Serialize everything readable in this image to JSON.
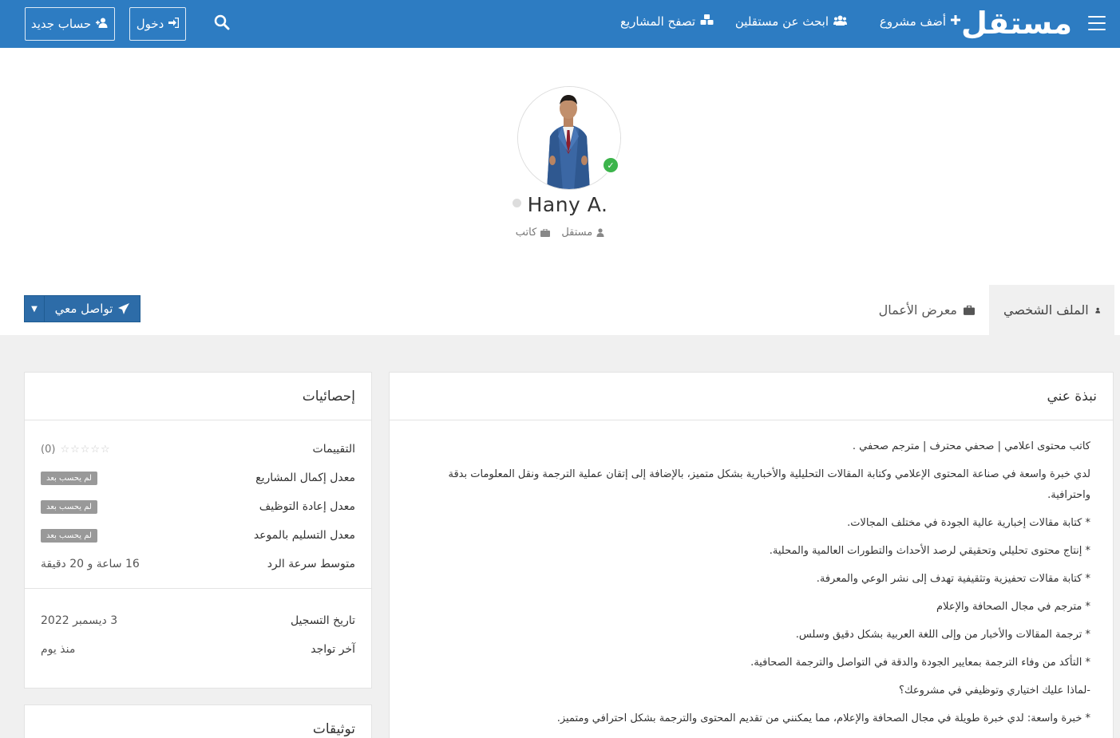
{
  "navbar": {
    "logo": "مستقل",
    "add_project": "أضف مشروع",
    "find_freelancers": "ابحث عن مستقلين",
    "browse_projects": "تصفح المشاريع",
    "login": "دخول",
    "register": "حساب جديد",
    "bg_color": "#2d7cc2"
  },
  "profile": {
    "name": "Hany A.",
    "role": "مستقل",
    "title": "كاتب",
    "verified": true
  },
  "tabs": {
    "profile": "الملف الشخصي",
    "portfolio": "معرض الأعمال"
  },
  "contact": {
    "label": "تواصل معي"
  },
  "about": {
    "heading": "نبذة عني",
    "paragraphs": [
      "كاتب محتوى اعلامي | صحفي محترف | مترجم صحفي .",
      "لدي خبرة واسعة في صناعة المحتوى الإعلامي وكتابة المقالات التحليلية والأخبارية بشكل متميز، بالإضافة إلى إتقان عملية الترجمة ونقل المعلومات بدقة واحترافية.",
      "* كتابة مقالات إخبارية عالية الجودة في مختلف المجالات.",
      "* إنتاج محتوى تحليلي وتحقيقي لرصد الأحداث والتطورات العالمية والمحلية.",
      "* كتابة مقالات تحفيزية وتثقيفية تهدف إلى نشر الوعي والمعرفة.",
      "* مترجم في مجال الصحافة والإعلام",
      "* ترجمة المقالات والأخبار من وإلى اللغة العربية بشكل دقيق وسلس.",
      "* التأكد من وفاء الترجمة بمعايير الجودة والدقة في التواصل والترجمة الصحافية.",
      "-لماذا عليك اختياري وتوظيفي في مشروعك؟",
      "* خبرة واسعة: لدي خبرة طويلة في مجال الصحافة والإعلام، مما يمكنني من تقديم المحتوى والترجمة بشكل احترافي ومتميز."
    ]
  },
  "stats": {
    "heading": "إحصائيات",
    "ratings_label": "التقييمات",
    "ratings_count": "(0)",
    "completion_label": "معدل إكمال المشاريع",
    "rehire_label": "معدل إعادة التوظيف",
    "ontime_label": "معدل التسليم بالموعد",
    "not_calculated": "لم يحسب بعد",
    "response_label": "متوسط سرعة الرد",
    "response_value": "16 ساعة و 20 دقيقة",
    "registered_label": "تاريخ التسجيل",
    "registered_value": "3 ديسمبر 2022",
    "last_seen_label": "آخر تواجد",
    "last_seen_value": "منذ يوم"
  },
  "verifications": {
    "heading": "توثيقات"
  }
}
